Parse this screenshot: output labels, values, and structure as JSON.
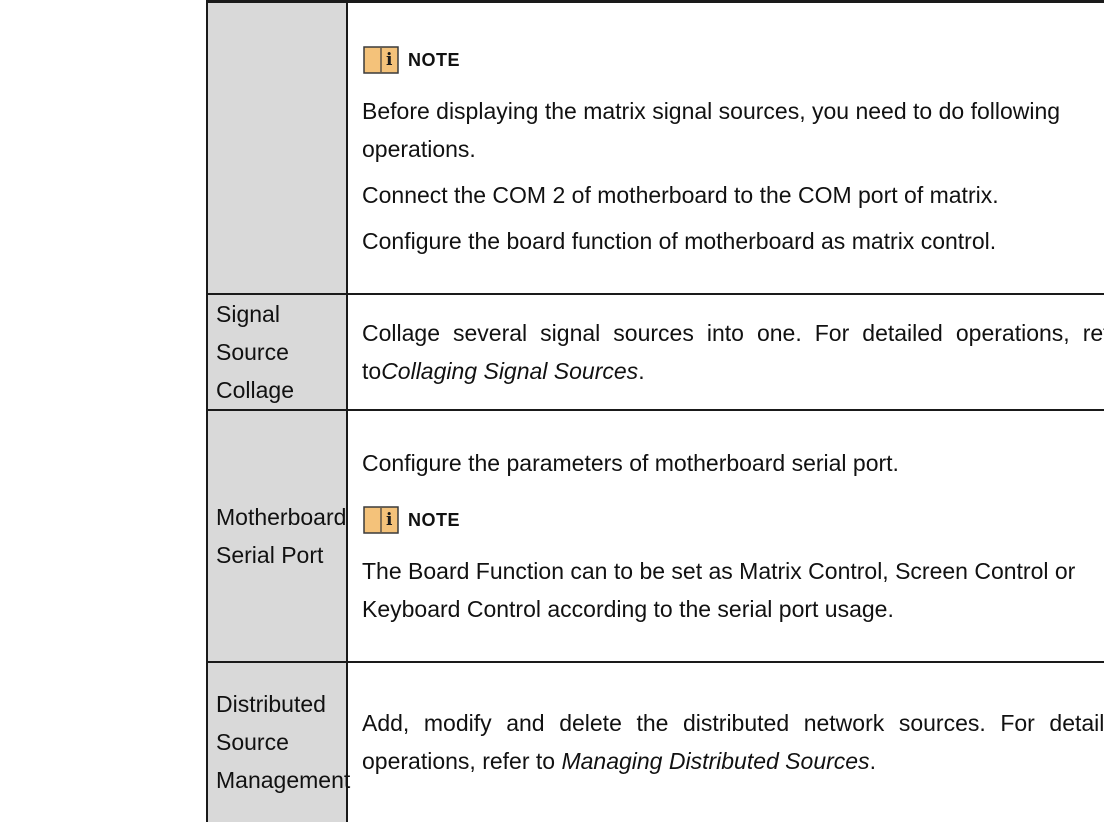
{
  "rows": [
    {
      "label": "",
      "note_label": "NOTE",
      "paragraphs": [
        "Before displaying the matrix signal sources, you need to do following operations.",
        "Connect the COM 2 of motherboard to the COM port of matrix.",
        "Configure the board function of motherboard as matrix control."
      ]
    },
    {
      "label": "Signal Source Collage",
      "text": "Collage several signal sources into one. For detailed operations, refer to",
      "ref": "Collaging Signal Sources",
      "suffix": "."
    },
    {
      "label": "Motherboard Serial Port",
      "text": "Configure the parameters of motherboard serial port.",
      "note_label": "NOTE",
      "note_text": "The Board Function can to be set as Matrix Control, Screen Control or Keyboard Control according to the serial port usage."
    },
    {
      "label": "Distributed Source Management",
      "text": "Add, modify and delete the distributed network sources. For detailed operations, refer to ",
      "ref": "Managing Distributed Sources",
      "suffix": "."
    }
  ],
  "colors": {
    "label_bg": "#d9d9d9",
    "note_icon_fill": "#f4c27a",
    "note_icon_stroke": "#3a3a3a",
    "border": "#1a1a1a"
  },
  "icons": {
    "note": "info-book-icon"
  }
}
